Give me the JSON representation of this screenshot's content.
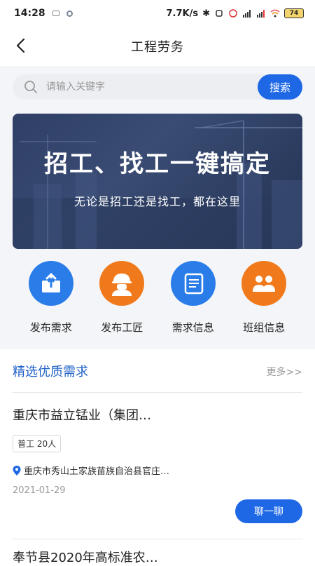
{
  "status_bar": {
    "time": "14:28",
    "net_speed": "7.7K/s",
    "battery": "74"
  },
  "nav": {
    "title": "工程劳务"
  },
  "search": {
    "placeholder": "请输入关键字",
    "button_label": "搜索"
  },
  "banner": {
    "headline": "招工、找工一键搞定",
    "subtitle": "无论是招工还是找工，都在这里"
  },
  "quick_actions": [
    {
      "label": "发布需求",
      "icon": "upload-box-icon",
      "color": "#2a7de9"
    },
    {
      "label": "发布工匠",
      "icon": "worker-helmet-icon",
      "color": "#f07a1b"
    },
    {
      "label": "需求信息",
      "icon": "document-list-icon",
      "color": "#2a7de9"
    },
    {
      "label": "班组信息",
      "icon": "team-people-icon",
      "color": "#f07a1b"
    }
  ],
  "section": {
    "title": "精选优质需求",
    "more_label": "更多>>"
  },
  "listings": [
    {
      "title": "重庆市益立锰业（集团…",
      "tag": "普工 20人",
      "location": "重庆市秀山土家族苗族自治县官庄…",
      "date": "2021-01-29",
      "chat_label": "聊一聊"
    },
    {
      "title": "奉节县2020年高标准农…"
    }
  ],
  "colors": {
    "accent": "#1e68e6",
    "title_blue": "#1e5fc8",
    "orange": "#f07a1b"
  }
}
